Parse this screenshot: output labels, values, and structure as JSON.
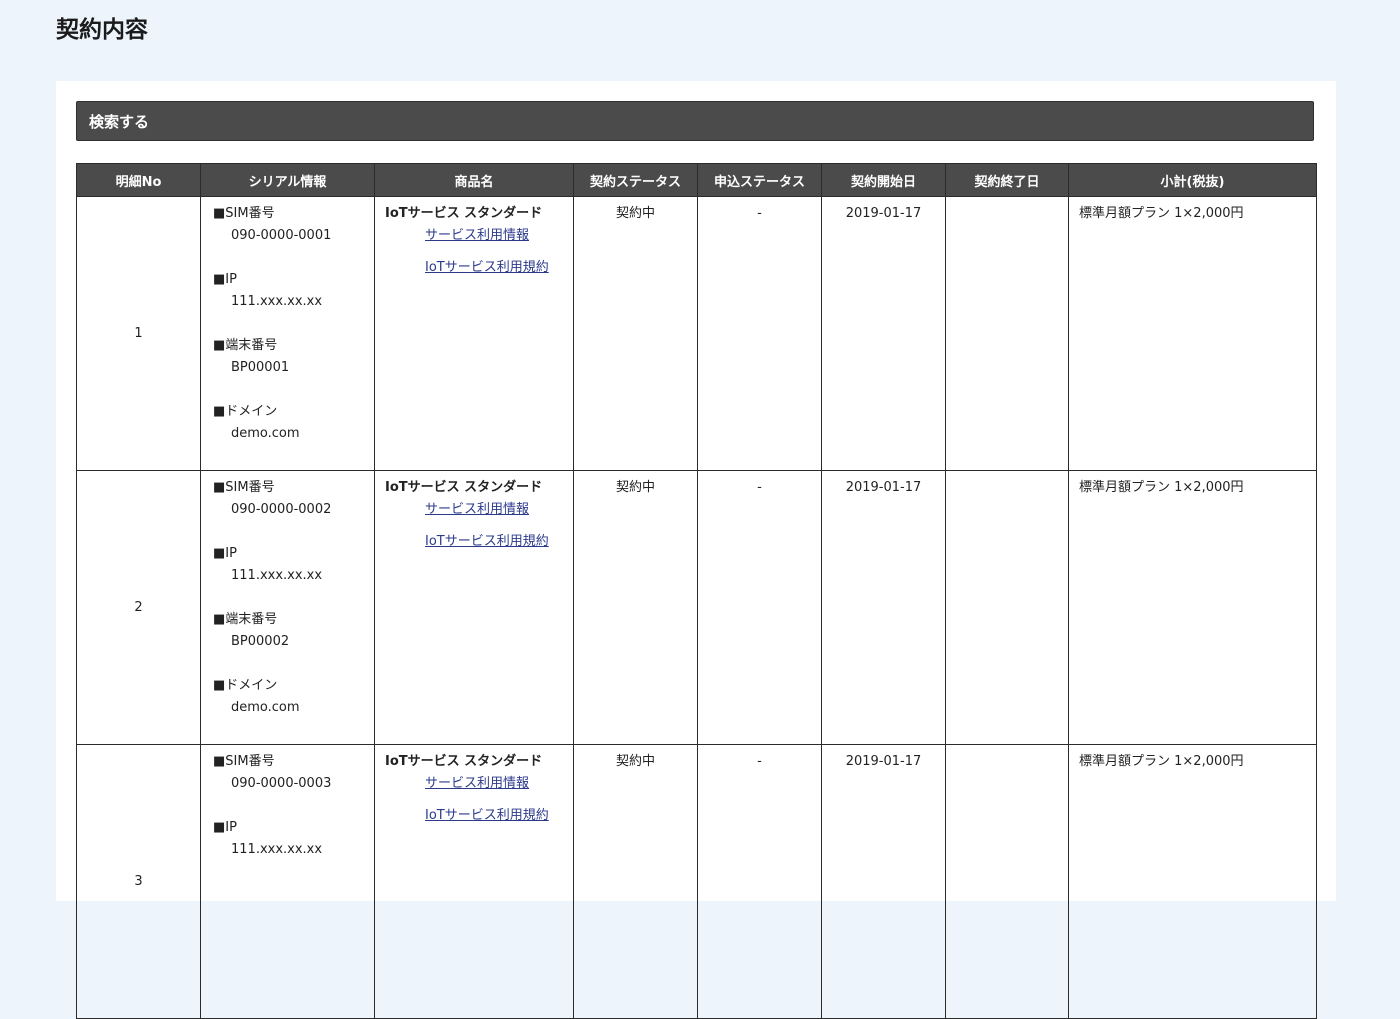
{
  "page_title": "契約内容",
  "search_label": "検索する",
  "columns": [
    "明細No",
    "シリアル情報",
    "商品名",
    "契約ステータス",
    "申込ステータス",
    "契約開始日",
    "契約終了日",
    "小計(税抜)"
  ],
  "serial_labels": {
    "sim": "■SIM番号",
    "ip": "■IP",
    "terminal": "■端末番号",
    "domain": "■ドメイン"
  },
  "rows": [
    {
      "no": "1",
      "sim": "090-0000-0001",
      "ip": "111.xxx.xx.xx",
      "terminal": "BP00001",
      "domain": "demo.com",
      "product": "IoTサービス スタンダード",
      "link1": "サービス利用情報",
      "link2": "IoTサービス利用規約",
      "contract_status": "契約中",
      "application_status": "-",
      "start_date": "2019-01-17",
      "end_date": "",
      "subtotal": "標準月額プラン 1×2,000円"
    },
    {
      "no": "2",
      "sim": "090-0000-0002",
      "ip": "111.xxx.xx.xx",
      "terminal": "BP00002",
      "domain": "demo.com",
      "product": "IoTサービス スタンダード",
      "link1": "サービス利用情報",
      "link2": "IoTサービス利用規約",
      "contract_status": "契約中",
      "application_status": "-",
      "start_date": "2019-01-17",
      "end_date": "",
      "subtotal": "標準月額プラン 1×2,000円"
    },
    {
      "no": "3",
      "sim": "090-0000-0003",
      "ip": "111.xxx.xx.xx",
      "terminal": "",
      "domain": "",
      "product": "IoTサービス スタンダード",
      "link1": "サービス利用情報",
      "link2": "IoTサービス利用規約",
      "contract_status": "契約中",
      "application_status": "-",
      "start_date": "2019-01-17",
      "end_date": "",
      "subtotal": "標準月額プラン 1×2,000円"
    }
  ]
}
